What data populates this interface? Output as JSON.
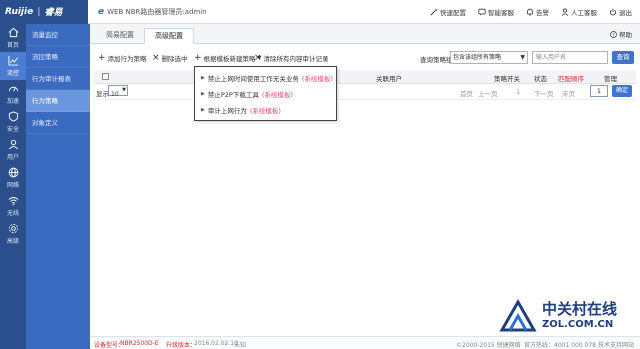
{
  "brand": {
    "logo": "Ruijie",
    "logo_cn": "睿易"
  },
  "header": {
    "product_prefix": "e",
    "product": "WEB NBR路由器管理员:admin",
    "actions": [
      {
        "label": "快速配置",
        "icon": "wand-icon"
      },
      {
        "label": "智能客服",
        "icon": "chat-icon"
      },
      {
        "label": "告警",
        "icon": "bell-icon"
      },
      {
        "label": "人工客服",
        "icon": "person-icon"
      },
      {
        "label": "退出",
        "icon": "power-icon"
      }
    ]
  },
  "leftnav": [
    {
      "label": "首页",
      "icon": "home-icon"
    },
    {
      "label": "流控",
      "icon": "chart-icon",
      "active": true
    },
    {
      "label": "加速",
      "icon": "speed-icon"
    },
    {
      "label": "安全",
      "icon": "shield-icon"
    },
    {
      "label": "用户",
      "icon": "user-icon"
    },
    {
      "label": "网络",
      "icon": "globe-icon"
    },
    {
      "label": "无线",
      "icon": "wifi-icon"
    },
    {
      "label": "高级",
      "icon": "gear-icon"
    }
  ],
  "subnav": [
    {
      "label": "流量监控"
    },
    {
      "label": "流控策略"
    },
    {
      "label": "行为审计报表"
    },
    {
      "label": "行为策略",
      "active": true
    },
    {
      "label": "对象定义"
    }
  ],
  "tabs": [
    {
      "label": "简易配置",
      "active": false
    },
    {
      "label": "高级配置",
      "active": true
    }
  ],
  "help_label": "帮助",
  "toolbar": {
    "add": "添加行为策略",
    "delete": "删除选中",
    "template": "根据模板新建策略",
    "clear": "清除所有内容审计记录",
    "search_label": "查询策略组:",
    "search_select": "包含该组所有策略",
    "search_placeholder": "输入用户名",
    "search_button": "查询"
  },
  "table": {
    "headers": {
      "user": "关联用户",
      "switch": "策略开关",
      "status": "状态",
      "match_order": "匹配顺序",
      "manage": "管理"
    },
    "page_label": "显示:",
    "page_size": "10",
    "pager": {
      "first": "首页",
      "prev": "上一页",
      "current": "1",
      "next": "下一页",
      "last": "末页"
    },
    "page_input": "1",
    "go_button": "确定"
  },
  "dropdown": [
    {
      "label": "禁止上网时间使用工作无关业务",
      "tag": "(系统模板)"
    },
    {
      "label": "禁止P2P下载工具",
      "tag": "(系统模板)"
    },
    {
      "label": "审计上网行为",
      "tag": "(系统模板)"
    }
  ],
  "footer": {
    "model_label": "设备型号：",
    "model": "NBR2500D-E",
    "version_label": "升级版本：",
    "version": "2016.02.02.10",
    "version_status": "未知",
    "copyright": "©2000-2015 锐捷网络",
    "hotline": "官方热线：4001 000 078",
    "support": "技术支持网站"
  },
  "watermark": {
    "text": "中关村在线",
    "url": "ZOL.COM.CN"
  },
  "colors": {
    "nav": "#2b4f8c",
    "subnav": "#3b6bc0",
    "accent": "#3f73cc",
    "red": "#d03030",
    "tag": "#e0506f"
  }
}
